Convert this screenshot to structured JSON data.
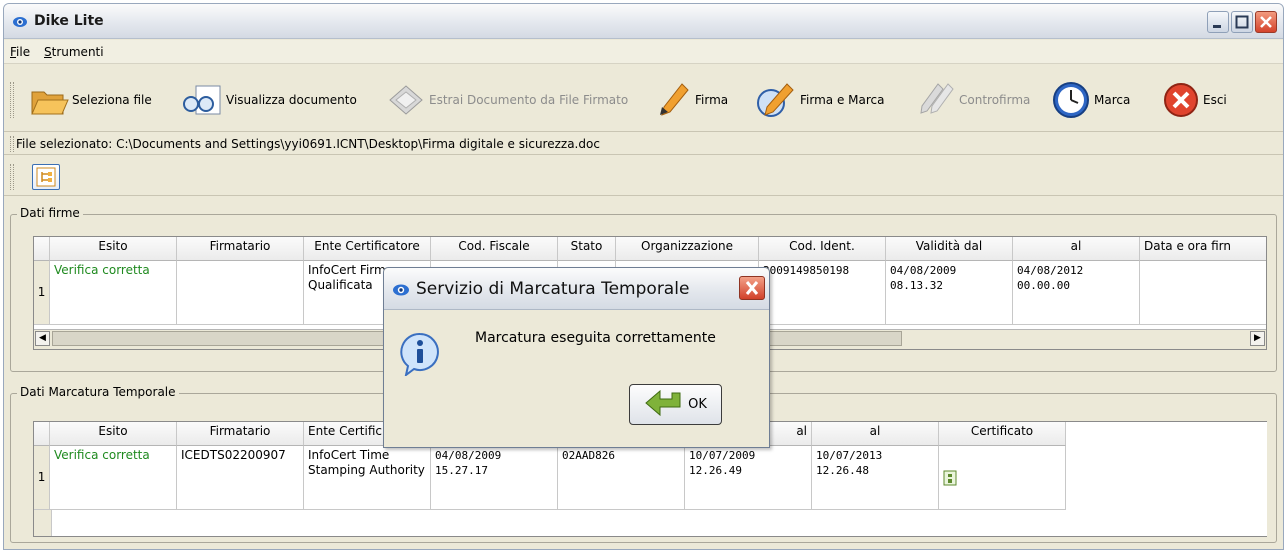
{
  "window": {
    "title": "Dike Lite"
  },
  "menu": [
    {
      "label": "File",
      "mnemonic": "F",
      "rest": "ile"
    },
    {
      "label": "Strumenti",
      "mnemonic": "S",
      "rest": "trumenti"
    }
  ],
  "toolbar": {
    "seleziona": "Seleziona file",
    "visualizza": "Visualizza documento",
    "estrai": "Estrai Documento da File Firmato",
    "firma": "Firma",
    "firma_marca": "Firma e Marca",
    "controfirma": "Controfirma",
    "marca": "Marca",
    "esci": "Esci"
  },
  "file_path": "File selezionato: C:\\Documents and Settings\\yyi0691.ICNT\\Desktop\\Firma digitale e sicurezza.doc",
  "firme": {
    "legend": "Dati firme",
    "columns": [
      "Esito",
      "Firmatario",
      "Ente Certificatore",
      "Cod. Fiscale",
      "Stato",
      "Organizzazione",
      "Cod. Ident.",
      "Validità dal",
      "al",
      "Data e ora firn"
    ],
    "row_number": "1",
    "row": [
      "Verifica corretta",
      "",
      "InfoCert Firm\nQualificata",
      "",
      "",
      "",
      "2009149850198",
      "04/08/2009\n08.13.32",
      "04/08/2012\n00.00.00",
      ""
    ]
  },
  "marcatura": {
    "legend": "Dati Marcatura Temporale",
    "columns": [
      "Esito",
      "Firmatario",
      "Ente Certific",
      "",
      "",
      "al",
      "al",
      "Certificato"
    ],
    "row_number": "1",
    "row": [
      "Verifica corretta",
      "ICEDTS02200907",
      "InfoCert Time\nStamping Authority",
      "04/08/2009\n15.27.17",
      "02AAD826",
      "10/07/2009\n12.26.49",
      "10/07/2013\n12.26.48",
      ""
    ]
  },
  "dialog": {
    "title": "Servizio di Marcatura Temporale",
    "message": "Marcatura eseguita correttamente",
    "ok": "OK"
  },
  "colors": {
    "ok_text": "#1f8a1f",
    "close_red": "#d4432b"
  }
}
